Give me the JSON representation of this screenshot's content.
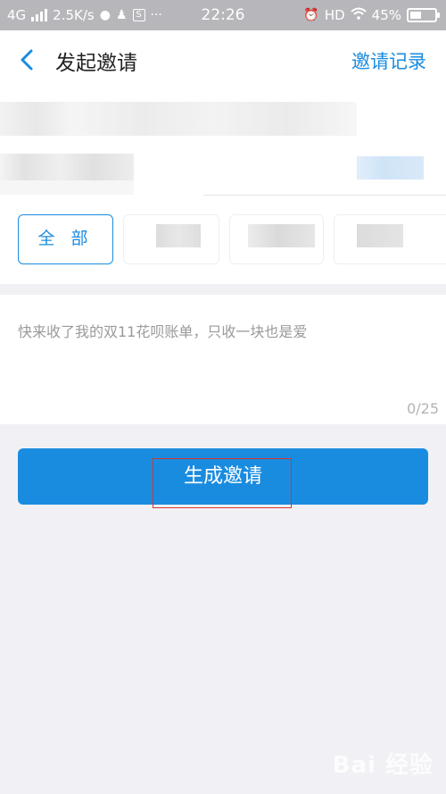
{
  "statusbar": {
    "network": "4G",
    "speed": "2.5K/s",
    "time": "22:26",
    "hd": "HD",
    "battery_pct": "45%",
    "battery_level": 0.45
  },
  "nav": {
    "title": "发起邀请",
    "action": "邀请记录"
  },
  "filters": {
    "active_label": "全 部"
  },
  "message": {
    "text": "快来收了我的双11花呗账单，只收一块也是爱",
    "counter": "0/25"
  },
  "primary_button": {
    "label": "生成邀请"
  },
  "watermark": {
    "text": "Bai 经验"
  },
  "colors": {
    "accent": "#1a8ce0",
    "highlight_box": "#d9342b"
  }
}
